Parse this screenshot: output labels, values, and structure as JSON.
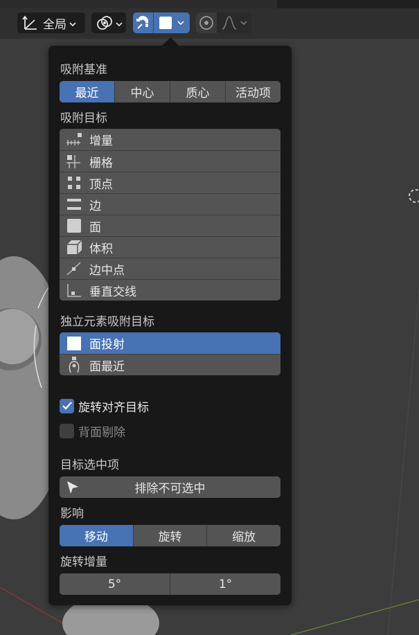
{
  "header": {
    "pivot_label": "全局",
    "icons": [
      "transform-orientation-icon",
      "pivot-point-icon",
      "snap-magnet-icon",
      "snap-face-icon",
      "proportional-edit-icon",
      "falloff-curve-icon"
    ]
  },
  "snap_popover": {
    "snap_base": {
      "label": "吸附基准",
      "options": [
        "最近",
        "中心",
        "质心",
        "活动项"
      ],
      "selected": "最近"
    },
    "snap_target": {
      "label": "吸附目标",
      "items": [
        {
          "label": "增量",
          "icon": "increment-icon"
        },
        {
          "label": "栅格",
          "icon": "grid-icon"
        },
        {
          "label": "顶点",
          "icon": "vertex-icon"
        },
        {
          "label": "边",
          "icon": "edge-icon"
        },
        {
          "label": "面",
          "icon": "face-icon"
        },
        {
          "label": "体积",
          "icon": "volume-icon"
        },
        {
          "label": "边中点",
          "icon": "edge-midpoint-icon"
        },
        {
          "label": "垂直交线",
          "icon": "perpendicular-icon"
        }
      ]
    },
    "individual_target": {
      "label": "独立元素吸附目标",
      "items": [
        {
          "label": "面投射",
          "icon": "face-project-icon",
          "active": true
        },
        {
          "label": "面最近",
          "icon": "face-nearest-icon",
          "active": false
        }
      ]
    },
    "align_rotation": {
      "label": "旋转对齐目标",
      "checked": true
    },
    "backface_culling": {
      "label": "背面剔除",
      "checked": false
    },
    "target_selection": {
      "label": "目标选中项",
      "button_label": "排除不可选中"
    },
    "affect": {
      "label": "影响",
      "options": [
        "移动",
        "旋转",
        "缩放"
      ],
      "selected": "移动"
    },
    "rotation_increment": {
      "label": "旋转增量",
      "values": [
        "5°",
        "1°"
      ]
    }
  },
  "colors": {
    "accent": "#4772b3",
    "popover_bg": "#181818",
    "button_bg": "#545454",
    "viewport_bg": "#3c3c3c"
  }
}
